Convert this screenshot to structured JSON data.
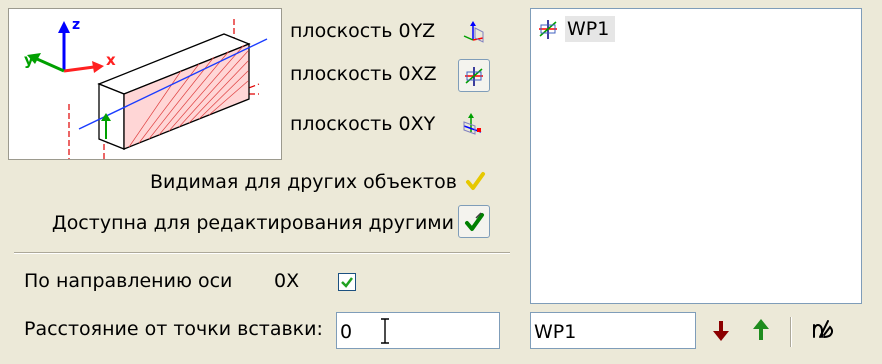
{
  "preview": {
    "axis_x": "x",
    "axis_y": "y",
    "axis_z": "z",
    "axis_colors": {
      "x": "#ff2020",
      "y": "#00a000",
      "z": "#0000ff"
    }
  },
  "planes": [
    {
      "label": "плоскость 0YZ",
      "icon": "plane-oyz-icon",
      "selected": false
    },
    {
      "label": "плоскость 0XZ",
      "icon": "plane-oxz-icon",
      "selected": true
    },
    {
      "label": "плоскость 0XY",
      "icon": "plane-oxy-icon",
      "selected": false
    }
  ],
  "options": {
    "visible_label": "Видимая для других объектов",
    "editable_label": "Доступна для редактирования другими"
  },
  "direction": {
    "label": "По направлению оси",
    "axis": "0X",
    "checked": true
  },
  "distance": {
    "label": "Расстояние от точки вставки:",
    "value": "0"
  },
  "workplanes": {
    "items": [
      {
        "label": "WP1",
        "icon": "workplane-icon"
      }
    ]
  },
  "name_field": {
    "value": "WP1"
  },
  "colors": {
    "background": "#ece9d8",
    "arrow_down": "#8b0000",
    "arrow_up": "#1e8c1e",
    "checkmark": "#008000",
    "yellow_check": "#ffd700"
  }
}
